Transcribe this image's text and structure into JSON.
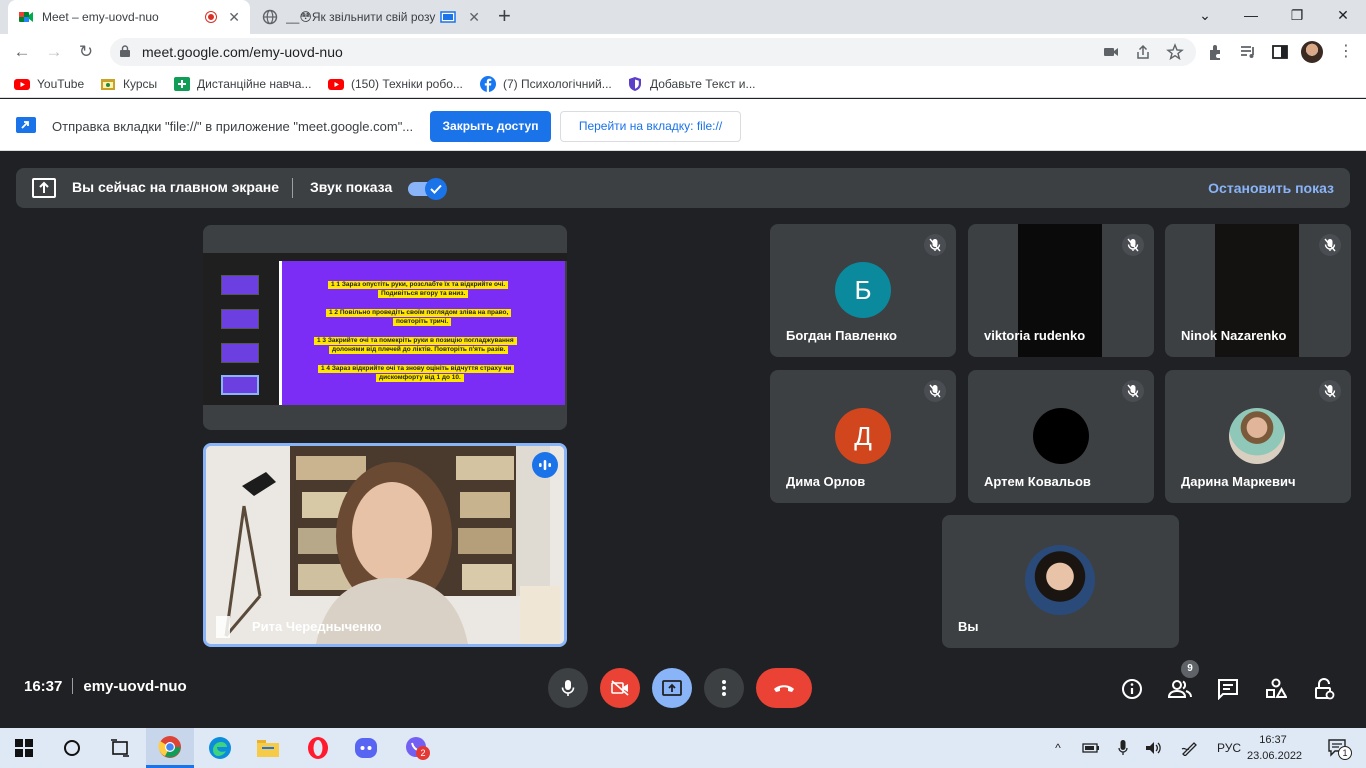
{
  "browser": {
    "tabs": [
      {
        "title": "Meet – emy-uovd-nuo",
        "active": true
      },
      {
        "title": "__😳Як звільнити свій розу",
        "active": false
      }
    ],
    "url": "meet.google.com/emy-uovd-nuo",
    "bookmarks": [
      {
        "label": "YouTube",
        "icon": "youtube-icon"
      },
      {
        "label": "Курсы",
        "icon": "folder-icon"
      },
      {
        "label": "Дистанційне навча...",
        "icon": "classroom-icon"
      },
      {
        "label": "(150) Техніки робо...",
        "icon": "youtube-icon"
      },
      {
        "label": "(7) Психологічний...",
        "icon": "facebook-icon"
      },
      {
        "label": "Добавьте Текст и...",
        "icon": "shield-icon"
      }
    ],
    "infobar": {
      "message": "Отправка вкладки \"file://\" в приложение \"meet.google.com\"...",
      "primary": "Закрыть доступ",
      "secondary": "Перейти на вкладку: file://"
    }
  },
  "meet": {
    "presenting_bar": {
      "status": "Вы сейчас на главном экране",
      "audio_label": "Звук показа",
      "audio_on": true,
      "stop": "Остановить показ"
    },
    "slide_lines": [
      "1  1  Зараз опустіть руки, розслабте їх та відкрийте очі.",
      "Подивіться вгору та вниз.",
      "1  2  Повільно проведіть своїм поглядом зліва на право,",
      "повторіть тричі.",
      "1  3  Закрийте очі та помекріть руки в позицію погладжування",
      "долонями від плечей до ліктів. Повторіть п'ять разів.",
      "1  4  Зараз відкрийте очі та знову оцініть відчуття страху чи",
      "дискомфорту від 1 до 10."
    ],
    "speaker": {
      "name": "Рита Чередныченко"
    },
    "participants": [
      {
        "name": "Богдан Павленко",
        "initial": "Б",
        "color": "#0b8a9e",
        "type": "initial"
      },
      {
        "name": "viktoria rudenko",
        "type": "video"
      },
      {
        "name": "Ninok Nazarenko",
        "type": "video"
      },
      {
        "name": "Дима Орлов",
        "initial": "Д",
        "color": "#d2461e",
        "type": "initial"
      },
      {
        "name": "Артем Ковальов",
        "type": "black"
      },
      {
        "name": "Дарина Маркевич",
        "type": "photo"
      }
    ],
    "self": {
      "name": "Вы"
    },
    "time": "16:37",
    "meeting_code": "emy-uovd-nuo",
    "people_count": "9"
  },
  "taskbar": {
    "lang": "РУС",
    "time": "16:37",
    "date": "23.06.2022",
    "viber_badge": "2",
    "notif_badge": "1"
  }
}
